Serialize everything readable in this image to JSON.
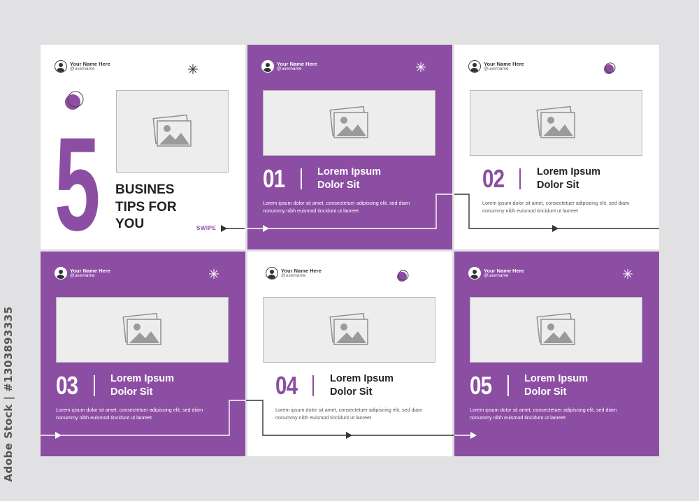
{
  "watermark": {
    "side_text": "Adobe Stock | #1303893335"
  },
  "author": {
    "name": "Your Name Here",
    "handle": "@username"
  },
  "cover": {
    "number": "5",
    "title_lines": [
      "BUSINES",
      "TIPS FOR",
      "YOU"
    ],
    "swipe_label": "SWIPE"
  },
  "tips": [
    {
      "number": "01",
      "title_line1": "Lorem Ipsum",
      "title_line2": "Dolor Sit",
      "body_line1": "Lorem ipsum dolor sit amet, consectetuer adipiscing elit, sed diam",
      "body_line2": "nonummy nibh euismod tincidunt ut laoreet"
    },
    {
      "number": "02",
      "title_line1": "Lorem Ipsum",
      "title_line2": "Dolor Sit",
      "body_line1": "Lorem ipsum dolor sit amet, consectetuer adipiscing elit, sed diam",
      "body_line2": "nonummy nibh euismod tincidunt ut laoreet"
    },
    {
      "number": "03",
      "title_line1": "Lorem Ipsum",
      "title_line2": "Dolor Sit",
      "body_line1": "Lorem ipsum dolor sit amet, consectetuer adipiscing elit, sed diam",
      "body_line2": "nonummy nibh euismod tincidunt ut laoreet"
    },
    {
      "number": "04",
      "title_line1": "Lorem Ipsum",
      "title_line2": "Dolor Sit",
      "body_line1": "Lorem ipsum dolor sit amet, consectetuer adipiscing elit, sed diam",
      "body_line2": "nonummy nibh euismod tincidunt ut laoreet"
    },
    {
      "number": "05",
      "title_line1": "Lorem Ipsum",
      "title_line2": "Dolor Sit",
      "body_line1": "Lorem ipsum dolor sit amet, consectetuer adipiscing elit, sed diam",
      "body_line2": "nonummy nibh euismod tincidunt ut laoreet"
    }
  ],
  "colors": {
    "accent_purple": "#8c4ea3",
    "background": "#e1e1e3",
    "panel_white": "#ffffff",
    "text_dark": "#222222",
    "placeholder_fill": "#ededee"
  },
  "icons": [
    "user-avatar-icon",
    "sparkle-icon",
    "image-placeholder-icon",
    "arrow-right-icon"
  ]
}
